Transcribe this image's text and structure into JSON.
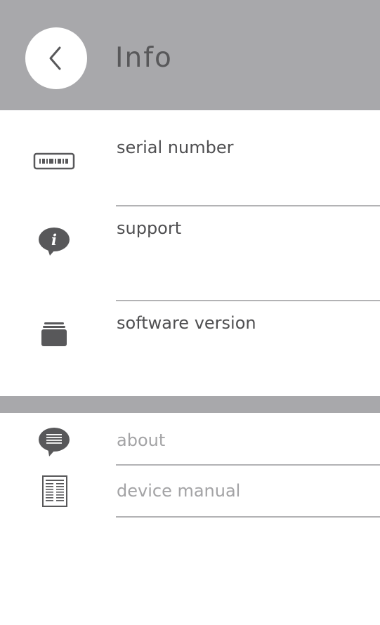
{
  "header": {
    "title": "Info",
    "back_icon": "chevron-left-icon"
  },
  "info_items": [
    {
      "label": "serial number",
      "icon": "barcode-icon"
    },
    {
      "label": "support",
      "icon": "info-bubble-icon"
    },
    {
      "label": "software version",
      "icon": "stack-icon"
    }
  ],
  "secondary_items": [
    {
      "label": "about",
      "icon": "chat-lines-icon"
    },
    {
      "label": "device manual",
      "icon": "document-icon"
    }
  ],
  "colors": {
    "header_bg": "#a8a8ab",
    "title_text": "#58585a",
    "primary_text": "#4f4f51",
    "secondary_text": "#a3a3a5",
    "icon": "#58585a"
  }
}
